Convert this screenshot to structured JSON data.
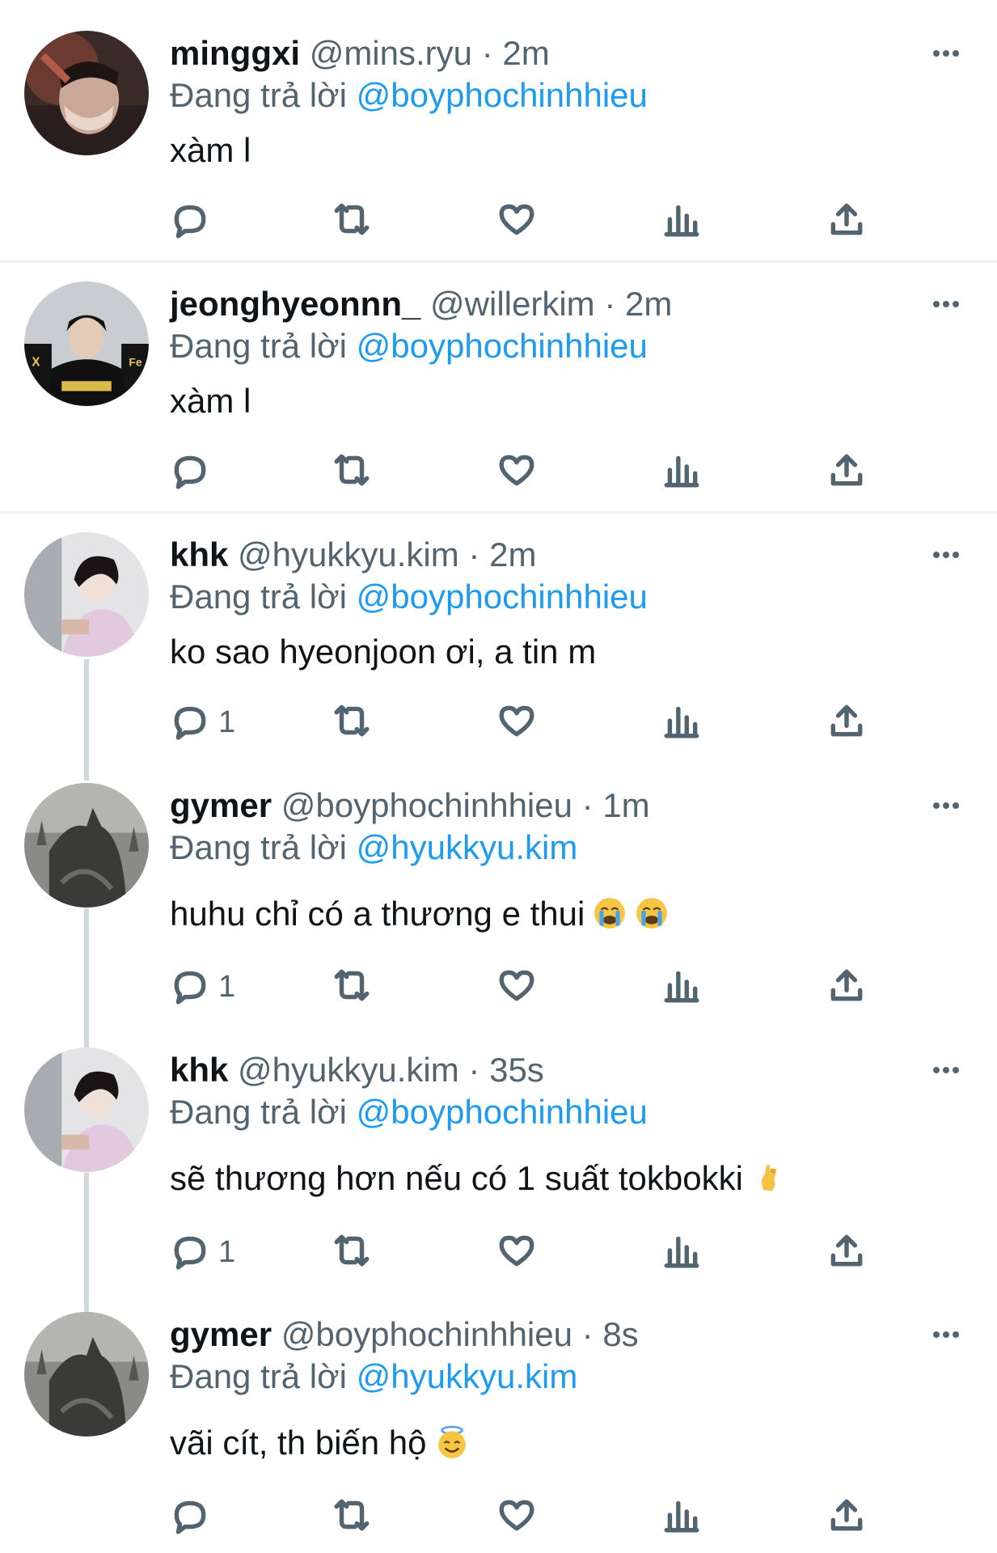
{
  "reply_prefix": "Đang trả lời",
  "tweets": [
    {
      "name": "minggxi",
      "handle": "@mins.ryu",
      "dot": "·",
      "time": "2m",
      "reply_to": "@boyphochinhhieu",
      "text": "xàm l",
      "reply_count": "",
      "emoji": []
    },
    {
      "name": "jeonghyeonnn_",
      "handle": "@willerkim",
      "dot": "·",
      "time": "2m",
      "reply_to": "@boyphochinhhieu",
      "text": "xàm l",
      "reply_count": "",
      "emoji": []
    },
    {
      "name": "khk",
      "handle": "@hyukkyu.kim",
      "dot": "·",
      "time": "2m",
      "reply_to": "@boyphochinhhieu",
      "text": "ko sao hyeonjoon ơi, a tin m",
      "reply_count": "1",
      "emoji": []
    },
    {
      "name": "gymer",
      "handle": "@boyphochinhhieu",
      "dot": "·",
      "time": "1m",
      "reply_to": "@hyukkyu.kim",
      "text": "huhu chỉ có a thương e thui",
      "reply_count": "1",
      "emoji": [
        "loudly-crying-face",
        "loudly-crying-face"
      ]
    },
    {
      "name": "khk",
      "handle": "@hyukkyu.kim",
      "dot": "·",
      "time": "35s",
      "reply_to": "@boyphochinhhieu",
      "text": "sẽ thương hơn nếu có 1 suất tokbokki",
      "reply_count": "1",
      "emoji": [
        "pinching-hand"
      ]
    },
    {
      "name": "gymer",
      "handle": "@boyphochinhhieu",
      "dot": "·",
      "time": "8s",
      "reply_to": "@hyukkyu.kim",
      "text": "vãi cít, th biến hộ",
      "reply_count": "",
      "emoji": [
        "smiling-face-with-halo"
      ]
    }
  ],
  "icons": {
    "reply": "reply-icon",
    "retweet": "retweet-icon",
    "like": "heart-icon",
    "views": "views-icon",
    "share": "share-icon",
    "more": "more-icon"
  },
  "colors": {
    "mention": "#1d9bf0",
    "secondary": "#536471",
    "thread_line": "#cfd9de"
  }
}
